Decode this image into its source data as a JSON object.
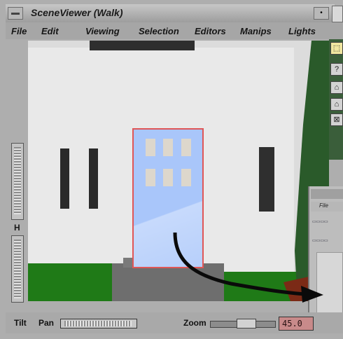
{
  "window": {
    "title": "SceneViewer (Walk)",
    "minimize_glyph": "•"
  },
  "menubar": {
    "items": [
      "File",
      "Edit",
      "Viewing",
      "Selection",
      "Editors",
      "Manips",
      "Lights"
    ]
  },
  "viewer": {
    "wheel_h_label": "H",
    "tilt_label": "Tilt",
    "pan_label": "Pan",
    "zoom_label": "Zoom",
    "zoom_value": "45.0"
  },
  "toolbar": {
    "icons": [
      "pick-icon",
      "help-icon",
      "home-icon",
      "set-home-icon",
      "view-all-icon"
    ],
    "glyphs": [
      "⬚",
      "?",
      "⌂",
      "⌂",
      "⊠"
    ]
  },
  "second_window": {
    "menu_file": "File"
  },
  "colors": {
    "door": "#a9c6fa",
    "door_border": "#e05656",
    "grass": "#1f7a17",
    "wall": "#e9e9e9",
    "zoom_field": "#c88a8a"
  }
}
